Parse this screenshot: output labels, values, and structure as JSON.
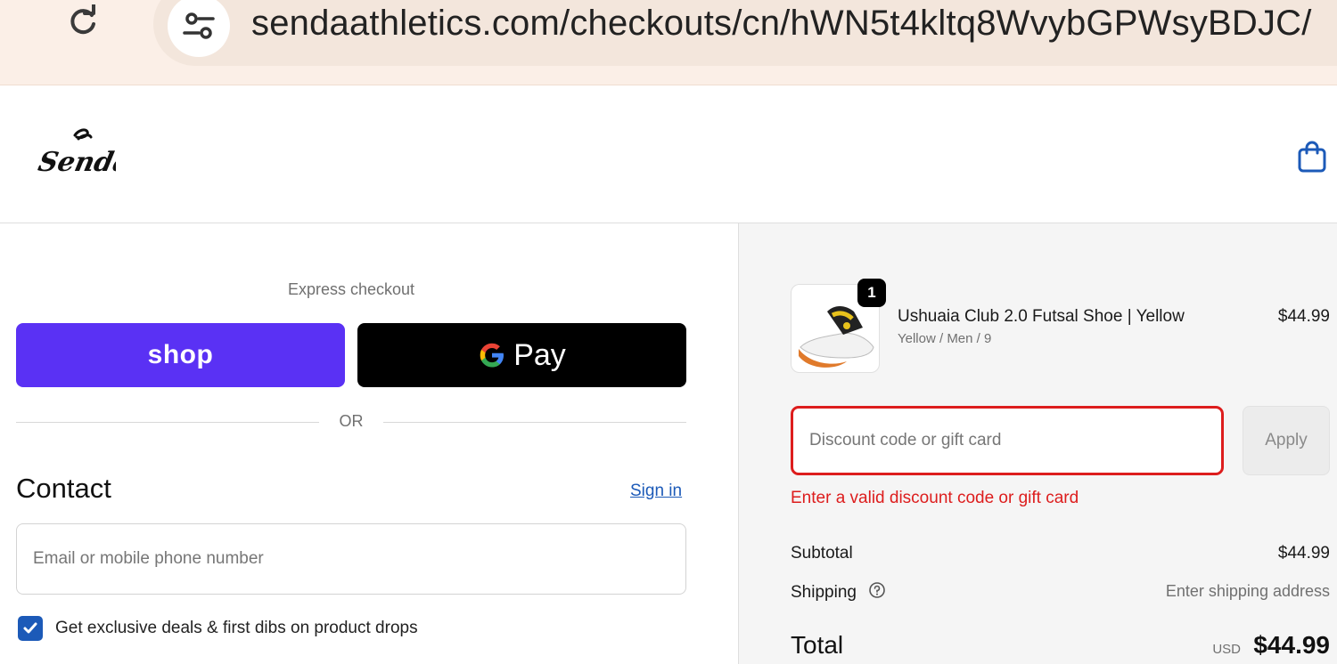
{
  "browser": {
    "url": "sendaathletics.com/checkouts/cn/hWN5t4kltq8WvybGPWsyBDJC/"
  },
  "header": {
    "logo_text": "Senda"
  },
  "express_checkout": {
    "label": "Express checkout",
    "shop_label": "shop",
    "gpay_label": "Pay",
    "or_label": "OR"
  },
  "contact": {
    "title": "Contact",
    "signin_label": "Sign in",
    "email_placeholder": "Email or mobile phone number",
    "email_value": "",
    "opt_in_label": "Get exclusive deals & first dibs on product drops",
    "opt_in_checked": true
  },
  "order": {
    "item": {
      "quantity": "1",
      "name": "Ushuaia Club 2.0 Futsal Shoe | Yellow",
      "variant": "Yellow / Men / 9",
      "price": "$44.99"
    },
    "discount": {
      "placeholder": "Discount code or gift card",
      "value": "",
      "apply_label": "Apply",
      "error": "Enter a valid discount code or gift card"
    },
    "summary": {
      "subtotal_label": "Subtotal",
      "subtotal_value": "$44.99",
      "shipping_label": "Shipping",
      "shipping_value": "Enter shipping address",
      "total_label": "Total",
      "total_currency": "USD",
      "total_value": "$44.99"
    }
  },
  "colors": {
    "shop_purple": "#5a31f4",
    "link_blue": "#1c5ab8",
    "error_red": "#dd1d1d"
  }
}
